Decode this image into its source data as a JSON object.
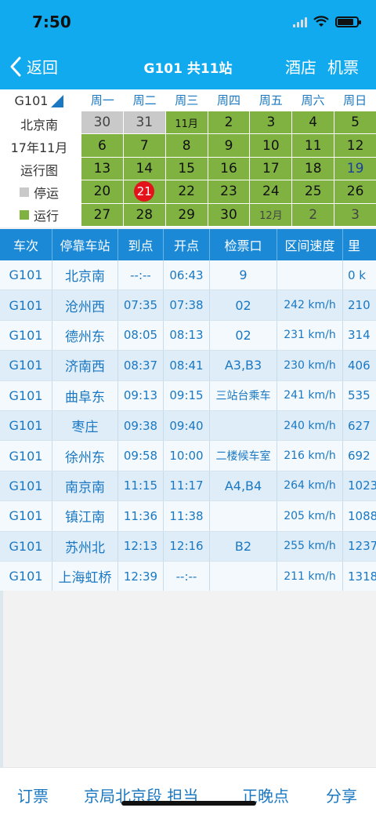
{
  "status": {
    "time": "7:50"
  },
  "nav": {
    "back_label": "返回",
    "title": "G101 共11站",
    "right": [
      "酒店",
      "机票"
    ]
  },
  "calendar": {
    "train_select": "G101",
    "station": "北京南",
    "month_label": "17年11月",
    "chart_label": "运行图",
    "legend_stop": "停运",
    "legend_run": "运行",
    "weekdays": [
      "周一",
      "周二",
      "周三",
      "周四",
      "周五",
      "周六",
      "周日"
    ],
    "cells": [
      "30",
      "31",
      "11月",
      "2",
      "3",
      "4",
      "5",
      "6",
      "7",
      "8",
      "9",
      "10",
      "11",
      "12",
      "13",
      "14",
      "15",
      "16",
      "17",
      "18",
      "19",
      "20",
      "21",
      "22",
      "23",
      "24",
      "25",
      "26",
      "27",
      "28",
      "29",
      "30",
      "12月",
      "2",
      "3"
    ],
    "today": "21",
    "colors": {
      "run": "#7fb241",
      "stop": "#c9c9c9",
      "today": "#e4121a",
      "accent": "#11aaee"
    }
  },
  "table": {
    "headers": [
      "车次",
      "停靠车站",
      "到点",
      "开点",
      "检票口",
      "区间速度",
      "里"
    ],
    "rows": [
      [
        "G101",
        "北京南",
        "--:--",
        "06:43",
        "9",
        "",
        "0 k"
      ],
      [
        "G101",
        "沧州西",
        "07:35",
        "07:38",
        "02",
        "242 km/h",
        "210"
      ],
      [
        "G101",
        "德州东",
        "08:05",
        "08:13",
        "02",
        "231 km/h",
        "314"
      ],
      [
        "G101",
        "济南西",
        "08:37",
        "08:41",
        "A3,B3",
        "230 km/h",
        "406"
      ],
      [
        "G101",
        "曲阜东",
        "09:13",
        "09:15",
        "三站台乘车",
        "241 km/h",
        "535"
      ],
      [
        "G101",
        "枣庄",
        "09:38",
        "09:40",
        "",
        "240 km/h",
        "627"
      ],
      [
        "G101",
        "徐州东",
        "09:58",
        "10:00",
        "二楼候车室",
        "216 km/h",
        "692"
      ],
      [
        "G101",
        "南京南",
        "11:15",
        "11:17",
        "A4,B4",
        "264 km/h",
        "1023"
      ],
      [
        "G101",
        "镇江南",
        "11:36",
        "11:38",
        "",
        "205 km/h",
        "1088"
      ],
      [
        "G101",
        "苏州北",
        "12:13",
        "12:16",
        "B2",
        "255 km/h",
        "1237"
      ],
      [
        "G101",
        "上海虹桥",
        "12:39",
        "--:--",
        "",
        "211 km/h",
        "1318"
      ]
    ]
  },
  "bottom": {
    "tabs": [
      "订票",
      "京局北京段 担当",
      "正晚点",
      "分享"
    ]
  }
}
